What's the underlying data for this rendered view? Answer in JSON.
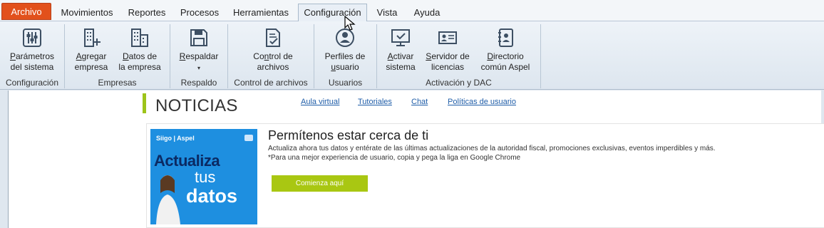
{
  "menu": {
    "tabs": [
      {
        "label": "Archivo"
      },
      {
        "label": "Movimientos"
      },
      {
        "label": "Reportes"
      },
      {
        "label": "Procesos"
      },
      {
        "label": "Herramientas"
      },
      {
        "label": "Configuración"
      },
      {
        "label": "Vista"
      },
      {
        "label": "Ayuda"
      }
    ],
    "active_tab": "Configuración"
  },
  "ribbon": {
    "groups": [
      {
        "label": "Configuración",
        "buttons": [
          {
            "label": "Parámetros del sistema",
            "icon": "settings-sliders-icon"
          }
        ]
      },
      {
        "label": "Empresas",
        "buttons": [
          {
            "label": "Agregar empresa",
            "icon": "building-add-icon"
          },
          {
            "label": "Datos de la empresa",
            "icon": "building-icon"
          }
        ]
      },
      {
        "label": "Respaldo",
        "buttons": [
          {
            "label": "Respaldar",
            "icon": "floppy-disk-icon"
          }
        ]
      },
      {
        "label": "Control  de archivos",
        "buttons": [
          {
            "label": "Control de archivos",
            "icon": "document-check-icon"
          }
        ]
      },
      {
        "label": "Usuarios",
        "buttons": [
          {
            "label": "Perfiles de usuario",
            "icon": "user-profile-icon"
          }
        ]
      },
      {
        "label": "Activación y DAC",
        "buttons": [
          {
            "label": "Activar sistema",
            "icon": "monitor-check-icon"
          },
          {
            "label": "Servidor de licencias",
            "icon": "license-card-icon"
          },
          {
            "label": "Directorio común Aspel",
            "icon": "directory-book-icon"
          }
        ]
      }
    ]
  },
  "news": {
    "title": "NOTICIAS",
    "links": [
      "Aula virtual",
      "Tutoriales",
      "Chat",
      "Políticas de usuario"
    ],
    "card": {
      "title": "Permítenos estar cerca de ti",
      "line1": "Actualiza ahora tus datos y entérate de las últimas actualizaciones de la autoridad fiscal, promociones exclusivas, eventos imperdibles y más.",
      "line2": "*Para una mejor experiencia de usuario, copia y pega la liga en Google Chrome",
      "button": "Comienza aquí",
      "banner": {
        "logo": "Siigo | Aspel",
        "word1": "Actualiza",
        "word2": "tus",
        "word3": "datos"
      }
    }
  },
  "colors": {
    "file_tab": "#e2511c",
    "accent_green": "#9dc41a",
    "cta": "#a9c712",
    "banner_blue": "#1e8fe0",
    "link": "#1f5da8"
  }
}
